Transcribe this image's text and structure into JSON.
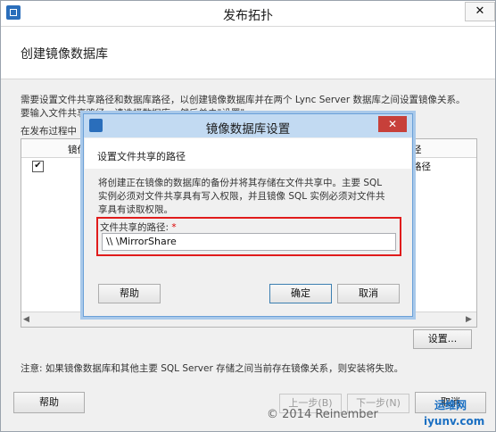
{
  "window": {
    "title": "发布拓扑",
    "close_glyph": "✕"
  },
  "page": {
    "title": "创建镜像数据库",
    "desc_line1": "需要设置文件共享路径和数据库路径，以创建镜像数据库并在两个 Lync Server 数据库之间设置镜像关系。",
    "desc_line2": "要输入文件共享路径，请选择数据库，然后单击\"设置\"。",
    "list_caption": "在发布过程中",
    "grid": {
      "col1_header": "镜像",
      "col2_header": "径",
      "row_col2": "路径",
      "row_checked": "✔"
    },
    "scroll_left": "◀",
    "scroll_right": "▶",
    "settings_button": "设置...",
    "note": "注意: 如果镜像数据库和其他主要 SQL Server 存储之间当前存在镜像关系，则安装将失败。",
    "help_button": "帮助",
    "prev_button": "上一步(B)",
    "next_button": "下一步(N)",
    "cancel_button": "取消"
  },
  "dialog": {
    "title": "镜像数据库设置",
    "close_glyph": "✕",
    "heading": "设置文件共享的路径",
    "p1": "将创建正在镜像的数据库的备份并将其存储在文件共享中。主要 SQL",
    "p2": "实例必须对文件共享具有写入权限，并且镜像 SQL 实例必须对文件共",
    "p3": "享具有读取权限。",
    "share_label": "文件共享的路径:",
    "required_mark": "*",
    "share_value": "\\\\            \\MirrorShare",
    "help_button": "帮助",
    "ok_button": "确定",
    "cancel_button": "取消"
  },
  "watermark": {
    "text": "© 2014 Reinember",
    "site1": "运维网",
    "site2": "iyunv.com"
  }
}
